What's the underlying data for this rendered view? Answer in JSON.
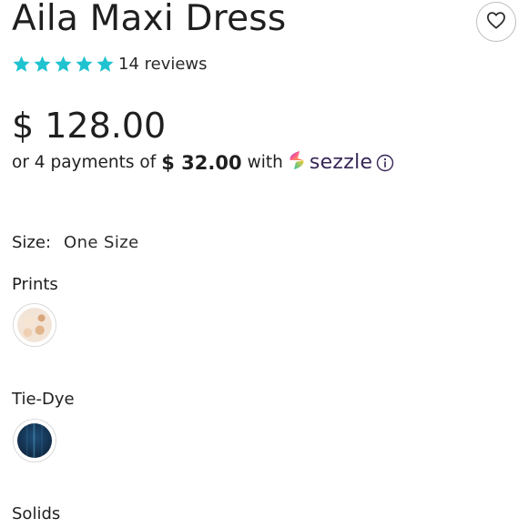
{
  "product": {
    "title": "Aila Maxi Dress",
    "rating": 5,
    "reviews_text": "14 reviews",
    "price": "$ 128.00"
  },
  "installment": {
    "prefix": "or 4 payments of",
    "amount": "$ 32.00",
    "with": "with",
    "provider": "sezzle"
  },
  "size": {
    "label": "Size:",
    "value": "One Size"
  },
  "swatch_groups": [
    {
      "label": "Prints"
    },
    {
      "label": "Tie-Dye"
    },
    {
      "label": "Solids"
    }
  ],
  "colors": {
    "star": "#1fc2cf",
    "sezzle_text": "#382757"
  },
  "icons": {
    "wishlist": "heart-icon",
    "info": "info-icon",
    "star": "star-icon"
  }
}
